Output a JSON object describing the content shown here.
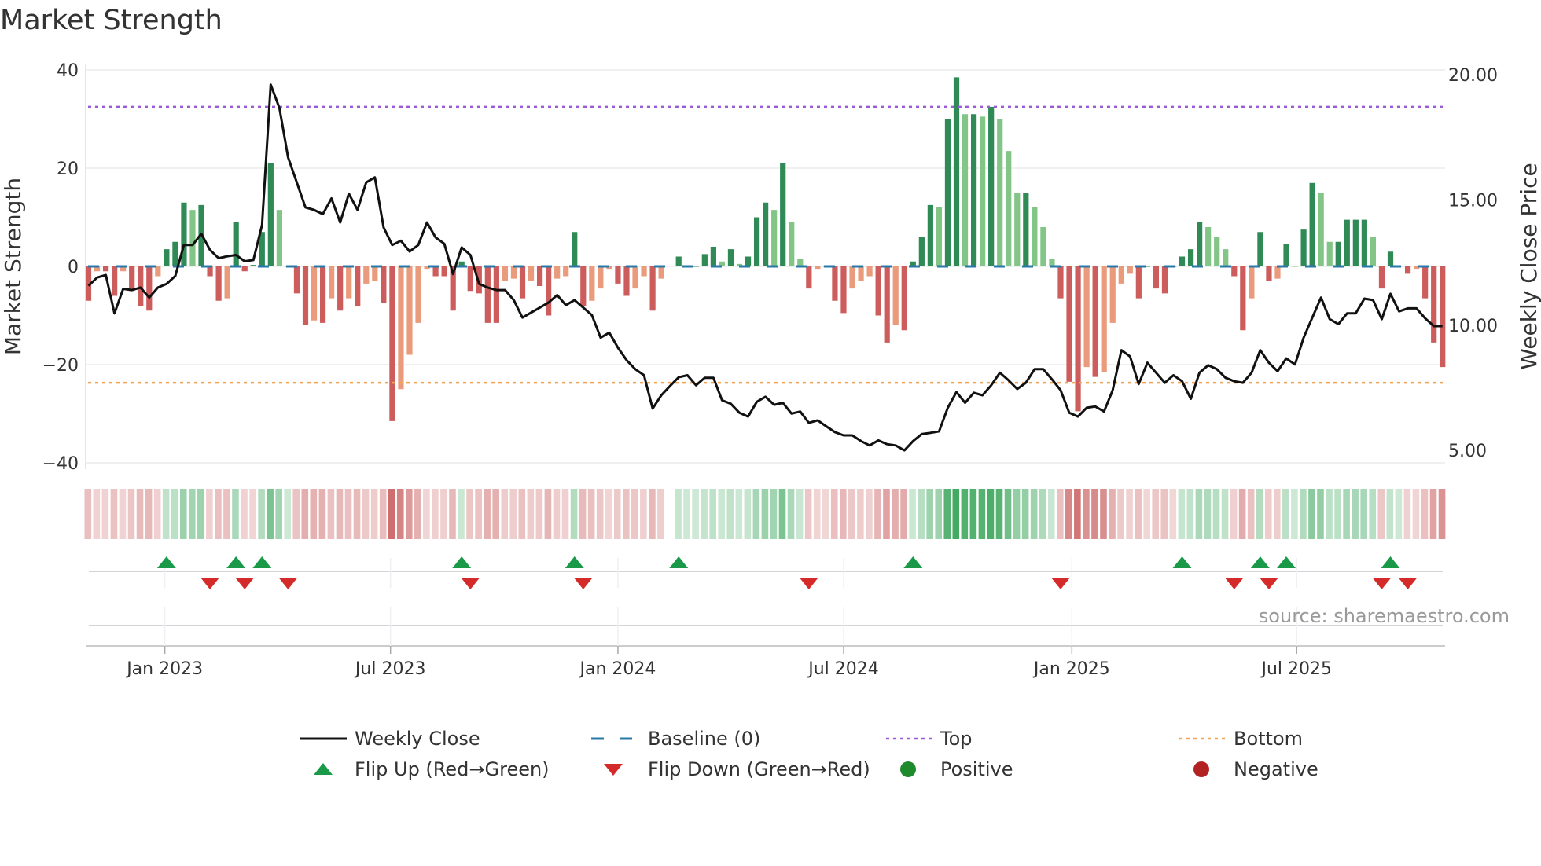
{
  "title": "Market Strength",
  "source": "source: sharemaestro.com",
  "colors": {
    "pos_strong": "#2f8a55",
    "pos_weak": "#82c587",
    "neg_strong": "#cd5c5c",
    "neg_weak": "#e99b7b",
    "top": "#9b5bd6",
    "bottom": "#f2a35a",
    "baseline": "#2a78a8",
    "flip_up": "#1a9a48",
    "flip_down": "#d42a2a",
    "price": "#111111"
  },
  "legend": [
    {
      "label": "Weekly Close",
      "icon": "solid-line"
    },
    {
      "label": "Baseline (0)",
      "icon": "dashed-line"
    },
    {
      "label": "Top",
      "icon": "dotted-line"
    },
    {
      "label": "Bottom",
      "icon": "dotted-line"
    },
    {
      "label": "Flip Up (Red→Green)",
      "icon": "triangle-up"
    },
    {
      "label": "Flip Down (Green→Red)",
      "icon": "triangle-down"
    },
    {
      "label": "Positive",
      "icon": "circle"
    },
    {
      "label": "Negative",
      "icon": "circle"
    }
  ],
  "chart_data": {
    "type": "bar",
    "title": "Market Strength",
    "xlabel": "",
    "ylabel": "Market Strength",
    "y2label": "Weekly Close Price",
    "ylim": [
      -42,
      41.5
    ],
    "y2lim": [
      4.6,
      20.4
    ],
    "yticks": [
      40,
      20,
      0,
      -20,
      -40
    ],
    "yticklabels": [
      "40",
      "20",
      "0",
      "−20",
      "−40"
    ],
    "y2ticks": [
      20,
      15,
      10,
      5
    ],
    "y2ticklabels": [
      "20.00",
      "15.00",
      "10.00",
      "5.00"
    ],
    "xticks": [
      8.8,
      34.8,
      61,
      87,
      113.3,
      139.2
    ],
    "xticklabels": [
      "Jan 2023",
      "Jul 2023",
      "Jan 2024",
      "Jul 2024",
      "Jan 2025",
      "Jul 2025"
    ],
    "grid": true,
    "legend_position": "bottom",
    "top_level": 32.5,
    "bottom_level": -23.7,
    "baseline": 0,
    "strength": [
      -7,
      -1,
      -1,
      -6,
      -1,
      -5,
      -8,
      -9,
      -2,
      3.5,
      5,
      13,
      11.5,
      12.5,
      -2,
      -7,
      -6.5,
      9,
      -1,
      0.3,
      7,
      21,
      11.5,
      0,
      -5.5,
      -12,
      -11,
      -11.5,
      -6.5,
      -9,
      -6.5,
      -8,
      -3.5,
      -3,
      -7.5,
      -31.5,
      -25,
      -18,
      -11.5,
      -0.5,
      -2,
      -2,
      -9,
      1,
      -5,
      -5.5,
      -11.5,
      -11.5,
      -3,
      -2.5,
      -6.5,
      -3,
      -4,
      -10,
      -2.5,
      -2,
      7,
      -8,
      -7,
      -4.5,
      -0.5,
      -3.5,
      -6,
      -4.5,
      -2,
      -9,
      -2.5,
      null,
      2,
      0,
      0,
      2.5,
      4,
      1,
      3.5,
      0.5,
      2,
      10,
      13,
      11.5,
      21,
      9,
      1.5,
      -4.5,
      -0.5,
      0,
      -7,
      -9.5,
      -4.5,
      -3,
      -2,
      -10,
      -15.5,
      -12,
      -13,
      1,
      6,
      12.5,
      12,
      30,
      38.5,
      31,
      31,
      30.5,
      32.5,
      30,
      23.5,
      15,
      15,
      12,
      8,
      1.5,
      -6.5,
      -23.5,
      -29.5,
      -20.5,
      -22.5,
      -21.5,
      -11.5,
      -3.5,
      -1.5,
      -6.5,
      0,
      -4.5,
      -5.5,
      0,
      2,
      3.5,
      9,
      8,
      6,
      3.5,
      -2,
      -13,
      -6.5,
      7,
      -3,
      -2.5,
      4.5,
      0,
      7.5,
      17,
      15,
      5,
      5,
      9.5,
      9.5,
      9.5,
      6,
      -4.5,
      3,
      0,
      -1.5,
      -0.5,
      -6.5,
      -15.5,
      -20.5
    ],
    "weekly_close": [
      11.57,
      11.9,
      12.0,
      10.47,
      11.45,
      11.4,
      11.5,
      11.1,
      11.5,
      11.65,
      11.96,
      13.2,
      13.2,
      13.65,
      13.0,
      12.67,
      12.75,
      12.8,
      12.55,
      12.6,
      14.0,
      19.6,
      18.67,
      16.7,
      15.7,
      14.7,
      14.6,
      14.43,
      15.06,
      14.1,
      15.25,
      14.6,
      15.7,
      15.9,
      13.9,
      13.2,
      13.37,
      12.94,
      13.2,
      14.1,
      13.5,
      13.25,
      12.04,
      13.1,
      12.8,
      11.65,
      11.5,
      11.4,
      11.4,
      11.0,
      10.3,
      10.5,
      10.7,
      10.9,
      11.2,
      10.8,
      11.0,
      10.7,
      10.4,
      9.5,
      9.7,
      9.1,
      8.6,
      8.24,
      8.0,
      6.67,
      7.2,
      7.57,
      7.92,
      8.0,
      7.6,
      7.9,
      7.9,
      7.0,
      6.86,
      6.5,
      6.35,
      6.94,
      7.14,
      6.82,
      6.9,
      6.47,
      6.55,
      6.1,
      6.2,
      5.96,
      5.73,
      5.6,
      5.6,
      5.37,
      5.2,
      5.4,
      5.25,
      5.2,
      5.0,
      5.37,
      5.65,
      5.7,
      5.76,
      6.7,
      7.33,
      6.9,
      7.3,
      7.2,
      7.6,
      8.1,
      7.8,
      7.45,
      7.7,
      8.24,
      8.24,
      7.84,
      7.4,
      6.5,
      6.35,
      6.7,
      6.75,
      6.55,
      7.4,
      9.0,
      8.75,
      7.65,
      8.5,
      8.1,
      7.7,
      8.0,
      7.76,
      7.06,
      8.1,
      8.4,
      8.24,
      7.9,
      7.76,
      7.7,
      8.1,
      9.0,
      8.5,
      8.16,
      8.67,
      8.43,
      9.5,
      10.3,
      11.1,
      10.24,
      10.04,
      10.47,
      10.47,
      11.06,
      11.0,
      10.24,
      11.25,
      10.55,
      10.67,
      10.67,
      10.27,
      9.96,
      9.96
    ],
    "flip_up_weeks": [
      9,
      17,
      20,
      43,
      56,
      68,
      95,
      126,
      135,
      138,
      150
    ],
    "flip_down_weeks": [
      14,
      18,
      23,
      44,
      57,
      83,
      112,
      132,
      136,
      149,
      152
    ]
  }
}
